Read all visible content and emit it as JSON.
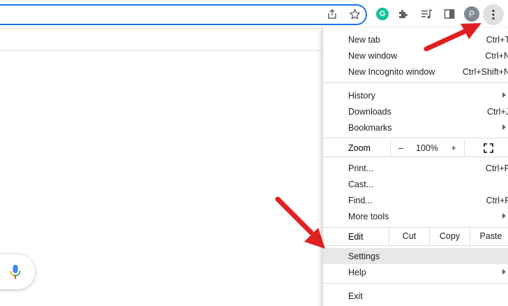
{
  "menu": {
    "new_tab": {
      "label": "New tab",
      "shortcut": "Ctrl+T"
    },
    "new_window": {
      "label": "New window",
      "shortcut": "Ctrl+N"
    },
    "incognito": {
      "label": "New Incognito window",
      "shortcut": "Ctrl+Shift+N"
    },
    "history": {
      "label": "History"
    },
    "downloads": {
      "label": "Downloads",
      "shortcut": "Ctrl+J"
    },
    "bookmarks": {
      "label": "Bookmarks"
    },
    "zoom": {
      "label": "Zoom",
      "minus": "–",
      "level": "100%",
      "plus": "+"
    },
    "print": {
      "label": "Print...",
      "shortcut": "Ctrl+P"
    },
    "cast": {
      "label": "Cast..."
    },
    "find": {
      "label": "Find...",
      "shortcut": "Ctrl+F"
    },
    "more_tools": {
      "label": "More tools"
    },
    "edit": {
      "label": "Edit",
      "cut": "Cut",
      "copy": "Copy",
      "paste": "Paste"
    },
    "settings": {
      "label": "Settings"
    },
    "help": {
      "label": "Help"
    },
    "exit": {
      "label": "Exit"
    }
  },
  "toolbar": {
    "avatar_letter": "P",
    "grammarly_letter": "G"
  },
  "colors": {
    "accent": "#1a73e8",
    "annotation_arrow": "#e02020",
    "highlight": "#e8e8e8"
  },
  "icons": [
    "share-icon",
    "star-icon",
    "grammarly-icon",
    "extensions-icon",
    "reading-list-icon",
    "side-panel-icon",
    "profile-avatar",
    "kebab-menu-icon",
    "microphone-icon",
    "fullscreen-icon"
  ]
}
